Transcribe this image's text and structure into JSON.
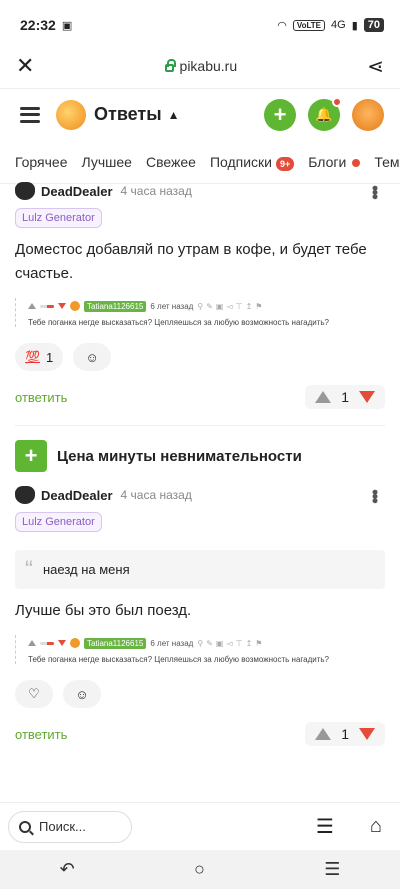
{
  "status": {
    "time": "22:32",
    "volte": "VoLTE",
    "network": "4G",
    "battery": "70"
  },
  "browser": {
    "url": "pikabu.ru"
  },
  "appbar": {
    "title": "Ответы"
  },
  "tabs": [
    {
      "label": "Горячее"
    },
    {
      "label": "Лучшее"
    },
    {
      "label": "Свежее"
    },
    {
      "label": "Подписки",
      "badge": "9+"
    },
    {
      "label": "Блоги"
    },
    {
      "label": "Темы"
    }
  ],
  "comment1": {
    "author": "DeadDealer",
    "time": "4 часа назад",
    "tag": "Lulz Generator",
    "text": "Доместос добавляй по утрам в кофе, и будет тебе счастье.",
    "embed": {
      "user": "Tatiana1126615",
      "time": "6 лет назад",
      "text": "Тебе поганка негде высказаться? Цепляешься за любую возможность нагадить?"
    },
    "reaction_count": "1",
    "reply": "ответить",
    "rating": "1"
  },
  "post": {
    "title": "Цена минуты невнимательности"
  },
  "comment2": {
    "author": "DeadDealer",
    "time": "4 часа назад",
    "tag": "Lulz Generator",
    "quote": "наезд на меня",
    "text": "Лучше бы это был поезд.",
    "embed": {
      "user": "Tatiana1126615",
      "time": "6 лет назад",
      "text": "Тебе поганка негде высказаться? Цепляешься за любую возможность нагадить?"
    },
    "reply": "ответить",
    "rating": "1"
  },
  "search": {
    "placeholder": "Поиск..."
  }
}
